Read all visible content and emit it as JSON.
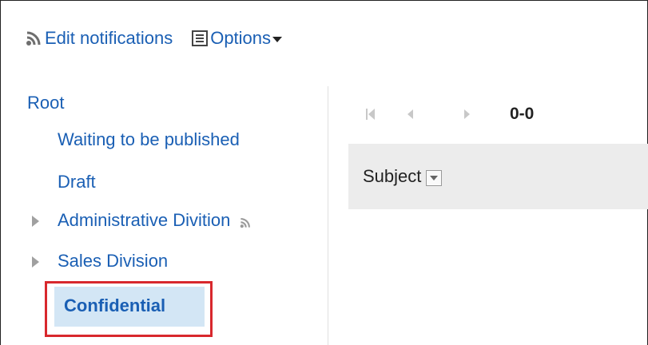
{
  "toolbar": {
    "edit_notifications": "Edit notifications",
    "options": "Options"
  },
  "tree": {
    "root": "Root",
    "items": [
      {
        "label": "Waiting to be published",
        "expandable": false
      },
      {
        "label": "Draft",
        "expandable": false
      },
      {
        "label": "Administrative Divition",
        "expandable": true,
        "notifications": true
      },
      {
        "label": "Sales Division",
        "expandable": true
      },
      {
        "label": "Confidential",
        "expandable": false,
        "selected": true
      }
    ]
  },
  "pager": {
    "count": "0-0"
  },
  "list": {
    "columns": [
      "Subject"
    ]
  },
  "colors": {
    "link": "#1a5fb4",
    "selected_bg": "#d3e6f5",
    "highlight_border": "#d8282d",
    "header_bg": "#ececec"
  }
}
